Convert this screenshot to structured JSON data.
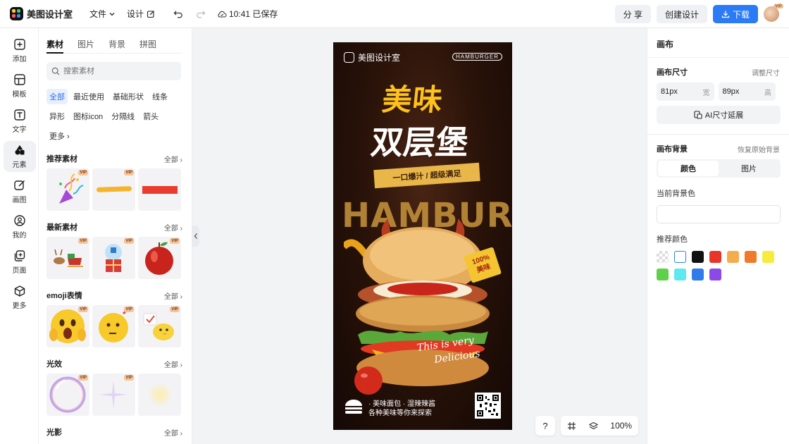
{
  "app": {
    "name": "美图设计室"
  },
  "topbar": {
    "menu": [
      {
        "label": "文件"
      },
      {
        "label": "设计"
      }
    ],
    "save_status": "10:41 已保存",
    "share_label": "分 享",
    "create_label": "创建设计",
    "download_label": "下载",
    "avatar_badge": "VIP"
  },
  "rail": {
    "items": [
      {
        "label": "添加",
        "icon": "plus-square-icon"
      },
      {
        "label": "模板",
        "icon": "template-icon"
      },
      {
        "label": "文字",
        "icon": "text-icon"
      },
      {
        "label": "元素",
        "icon": "element-icon"
      },
      {
        "label": "画图",
        "icon": "draw-icon"
      },
      {
        "label": "我的",
        "icon": "user-icon"
      },
      {
        "label": "页面",
        "icon": "add-page-icon"
      },
      {
        "label": "更多",
        "icon": "cube-icon"
      }
    ],
    "active_index": 3
  },
  "panel": {
    "tabs": [
      "素材",
      "图片",
      "背景",
      "拼图"
    ],
    "search_placeholder": "搜索素材",
    "chips": [
      "全部",
      "最近使用",
      "基础形状",
      "线条",
      "异形",
      "图标icon",
      "分隔线",
      "箭头",
      "更多"
    ],
    "sections": [
      {
        "title": "推荐素材",
        "all": "全部"
      },
      {
        "title": "最新素材",
        "all": "全部"
      },
      {
        "title": "emoji表情",
        "all": "全部"
      },
      {
        "title": "光效",
        "all": "全部"
      },
      {
        "title": "光影",
        "all": "全部"
      }
    ],
    "vip": "VIP"
  },
  "poster": {
    "logo": "美图设计室",
    "brand_tag": "HAMBURGER",
    "headline1": "美味",
    "headline2": "双层堡",
    "ribbon": "一口爆汁 / 超级满足",
    "big_word": "HAMBURGER",
    "stamp_line1": "100%",
    "stamp_line2": "美味",
    "script_line1": "This is very",
    "script_line2": "Delicious",
    "footer_line1": "· 美味面包 · 湿辣辣酱",
    "footer_line2": "各种美味等你来探索"
  },
  "canvas": {
    "zoom": "100%",
    "help": "?"
  },
  "right": {
    "title": "画布",
    "size_label": "画布尺寸",
    "size_link": "调整尺寸",
    "width_value": "81px",
    "width_unit": "宽",
    "height_value": "89px",
    "height_unit": "高",
    "ai_button": "AI尺寸延展",
    "bg_label": "画布背景",
    "bg_link": "恢复原始背景",
    "seg_color": "颜色",
    "seg_image": "图片",
    "current_label": "当前背景色",
    "recommended_label": "推荐颜色",
    "swatch_colors": [
      "transparent",
      "#ffffff",
      "#111111",
      "#e8352a",
      "#f4ad4c",
      "#ef7a2a",
      "#f7ec3e",
      "#5fd04a",
      "#5ee8ef",
      "#2f7bea",
      "#8b4ae8"
    ]
  }
}
